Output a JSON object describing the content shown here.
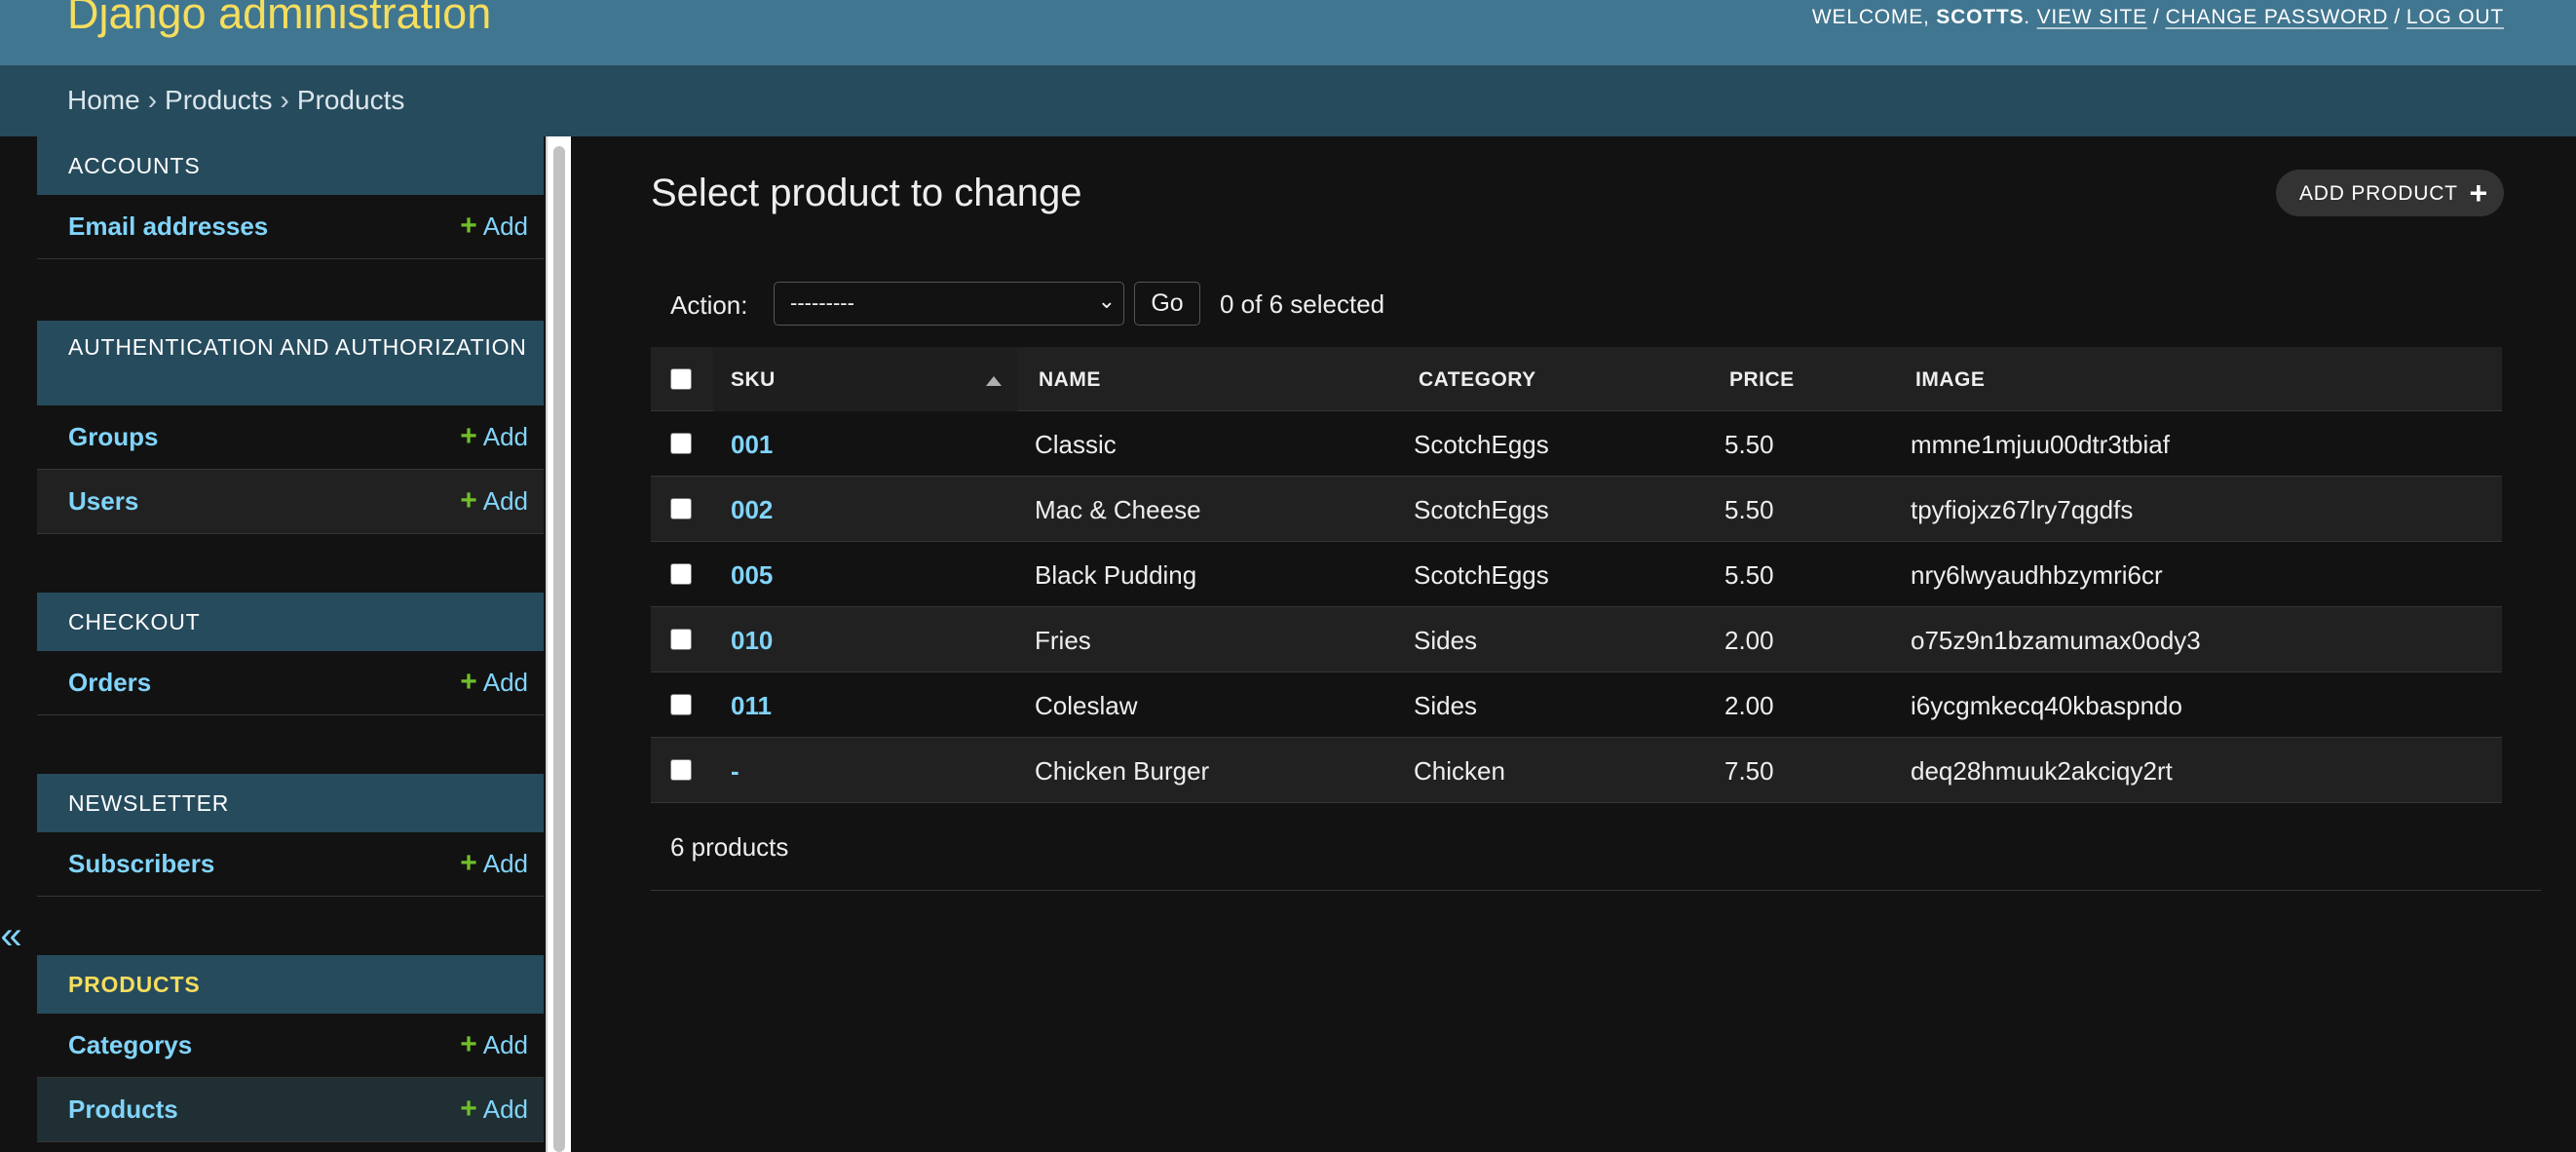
{
  "header": {
    "branding": "Django administration",
    "welcome": "WELCOME,",
    "username": "SCOTTS",
    "view_site": "VIEW SITE",
    "change_password": "CHANGE PASSWORD",
    "log_out": "LOG OUT"
  },
  "breadcrumbs": [
    "Home",
    "Products",
    "Products"
  ],
  "sidebar": {
    "toggle_glyph": "«",
    "add_label": "Add",
    "modules": [
      {
        "caption": "ACCOUNTS",
        "models": [
          "Email addresses"
        ]
      },
      {
        "caption": "AUTHENTICATION AND AUTHORIZATION",
        "models": [
          "Groups",
          "Users"
        ]
      },
      {
        "caption": "CHECKOUT",
        "models": [
          "Orders"
        ]
      },
      {
        "caption": "NEWSLETTER",
        "models": [
          "Subscribers"
        ]
      },
      {
        "caption": "PRODUCTS",
        "models": [
          "Categorys",
          "Products"
        ]
      }
    ]
  },
  "main": {
    "title": "Select product to change",
    "add_button": "ADD PRODUCT",
    "action_label": "Action:",
    "action_value": "---------",
    "go_label": "Go",
    "selection": "0 of 6 selected",
    "columns": [
      "SKU",
      "NAME",
      "CATEGORY",
      "PRICE",
      "IMAGE"
    ],
    "rows": [
      {
        "sku": "001",
        "name": "Classic",
        "category": "ScotchEggs",
        "price": "5.50",
        "image": "mmne1mjuu00dtr3tbiaf"
      },
      {
        "sku": "002",
        "name": "Mac & Cheese",
        "category": "ScotchEggs",
        "price": "5.50",
        "image": "tpyfiojxz67lry7qgdfs"
      },
      {
        "sku": "005",
        "name": "Black Pudding",
        "category": "ScotchEggs",
        "price": "5.50",
        "image": "nry6lwyaudhbzymri6cr"
      },
      {
        "sku": "010",
        "name": "Fries",
        "category": "Sides",
        "price": "2.00",
        "image": "o75z9n1bzamumax0ody3"
      },
      {
        "sku": "011",
        "name": "Coleslaw",
        "category": "Sides",
        "price": "2.00",
        "image": "i6ycgmkecq40kbaspndo"
      },
      {
        "sku": "-",
        "name": "Chicken Burger",
        "category": "Chicken",
        "price": "7.50",
        "image": "deq28hmuuk2akciqy2rt"
      }
    ],
    "paginator": "6 products"
  },
  "colors": {
    "header_bg": "#417690",
    "breadcrumb_bg": "#264b5d",
    "branding": "#f5dd5d",
    "link": "#81d4fa",
    "add_plus": "#70bf2b",
    "body_bg": "#121212"
  }
}
